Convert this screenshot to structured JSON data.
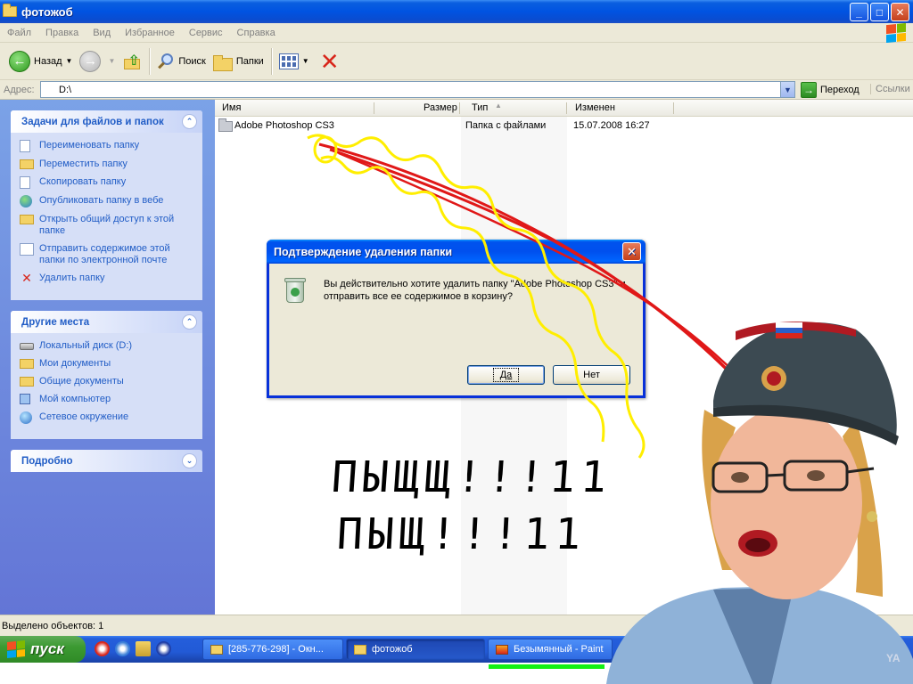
{
  "window": {
    "title": "фотожоб",
    "controls": [
      "_",
      "□",
      "✕"
    ]
  },
  "menu": [
    "Файл",
    "Правка",
    "Вид",
    "Избранное",
    "Сервис",
    "Справка"
  ],
  "toolbar": {
    "back_label": "Назад",
    "search_label": "Поиск",
    "folders_label": "Папки"
  },
  "address": {
    "label": "Адрес:",
    "value": "D:\\",
    "go_label": "Переход",
    "links_label": "Ссылки"
  },
  "tasks": {
    "file_tasks": {
      "title": "Задачи для файлов и папок",
      "items": [
        "Переименовать папку",
        "Переместить папку",
        "Скопировать папку",
        "Опубликовать папку в вебе",
        "Открыть общий доступ к этой папке",
        "Отправить содержимое этой папки по электронной почте",
        "Удалить папку"
      ]
    },
    "other_places": {
      "title": "Другие места",
      "items": [
        "Локальный диск (D:)",
        "Мои документы",
        "Общие документы",
        "Мой компьютер",
        "Сетевое окружение"
      ]
    },
    "details": {
      "title": "Подробно"
    }
  },
  "filelist": {
    "columns": [
      "Имя",
      "Размер",
      "Тип",
      "Изменен"
    ],
    "rows": [
      {
        "name": "Adobe Photoshop CS3",
        "size": "",
        "type": "Папка с файлами",
        "modified": "15.07.2008 16:27"
      }
    ]
  },
  "status": {
    "text": "Выделено объектов: 1"
  },
  "dialog": {
    "title": "Подтверждение удаления папки",
    "message": "Вы действительно хотите удалить папку \"Adobe Photoshop CS3\" и отправить все ее содержимое в корзину?",
    "yes_label": "Да",
    "no_label": "Нет"
  },
  "taskbar": {
    "start_label": "пуск",
    "tasks": [
      "[285-776-298] - Окн...",
      "фотожоб",
      "Безымянный - Paint"
    ]
  },
  "overlay": {
    "scribble_line1": "ПЫЩЩ!!!11",
    "scribble_line2": "ПЫЩ!!!11",
    "watermark": "YA"
  },
  "colors": {
    "xp_blue": "#0053e1",
    "task_pane": "#6375d6",
    "link_blue": "#215dc6",
    "start_green": "#3c9a32",
    "doodle_red": "#e01818",
    "doodle_yellow": "#ffee00"
  }
}
